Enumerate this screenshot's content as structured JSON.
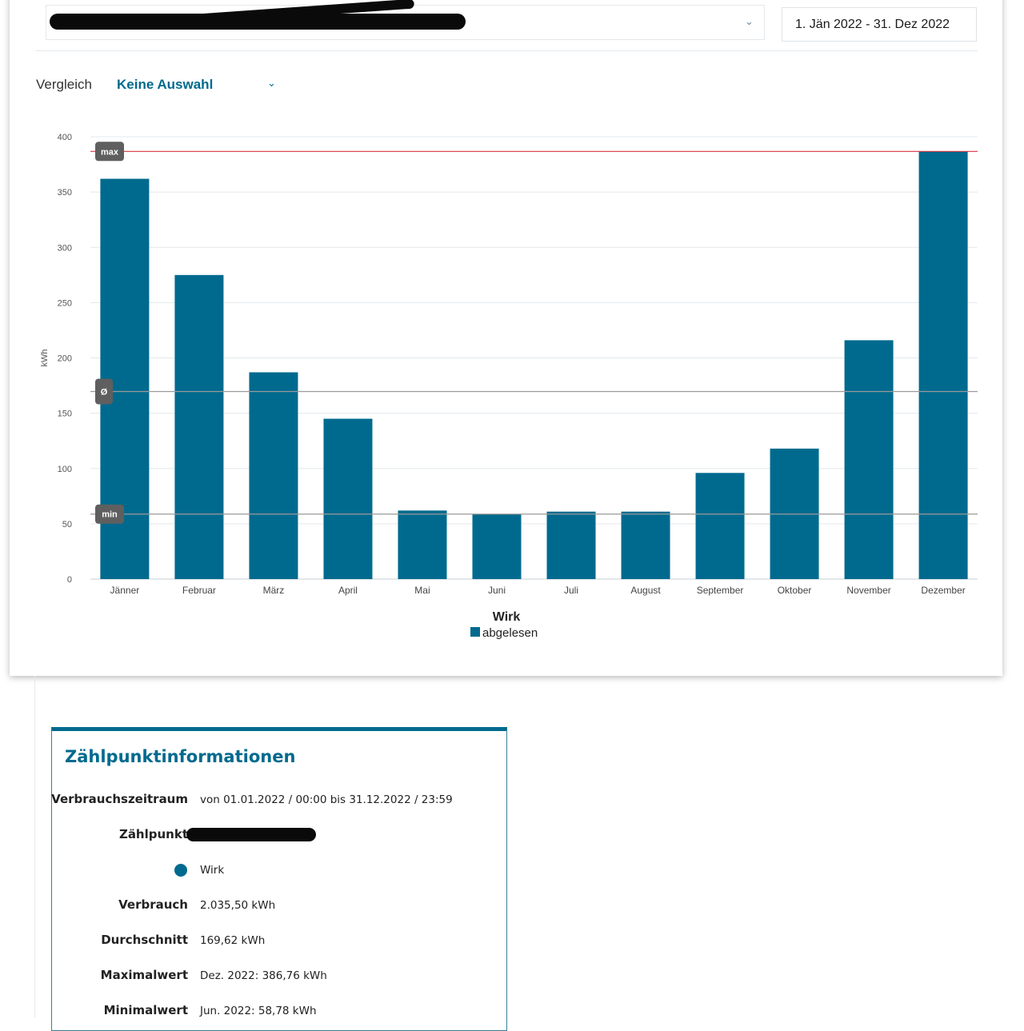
{
  "header": {
    "date_range": "1. Jän 2022 - 31. Dez 2022"
  },
  "comparison": {
    "label": "Vergleich",
    "selected": "Keine Auswahl"
  },
  "colors": {
    "accent": "#006a8e",
    "max_line": "#d9353f",
    "ref_line": "#9a9a9a",
    "badge": "#5f5f5f"
  },
  "chart_data": {
    "type": "bar",
    "title": "Wirk",
    "ylabel": "kWh",
    "ylim": [
      0,
      400
    ],
    "yticks": [
      0,
      50,
      100,
      150,
      200,
      250,
      300,
      350,
      400
    ],
    "categories": [
      "Jänner",
      "Februar",
      "März",
      "April",
      "Mai",
      "Juni",
      "Juli",
      "August",
      "September",
      "Oktober",
      "November",
      "Dezember"
    ],
    "series": [
      {
        "name": "abgelesen",
        "values": [
          362,
          275,
          187,
          145,
          62,
          58.78,
          61,
          61,
          96,
          118,
          216,
          386.76
        ]
      }
    ],
    "reference_lines": [
      {
        "label": "max",
        "value": 386.76
      },
      {
        "label": "Ø",
        "value": 169.62
      },
      {
        "label": "min",
        "value": 58.78
      }
    ],
    "legend": "bottom-center",
    "grid": true
  },
  "info": {
    "title": "Zählpunktinformationen",
    "rows": [
      {
        "label": "Verbrauchszeitraum",
        "value": "von 01.01.2022 / 00:00 bis 31.12.2022 / 23:59"
      },
      {
        "label": "Zählpunkt",
        "value": ""
      },
      {
        "label": "",
        "value": "Wirk"
      },
      {
        "label": "Verbrauch",
        "value": "2.035,50 kWh"
      },
      {
        "label": "Durchschnitt",
        "value": "169,62 kWh"
      },
      {
        "label": "Maximalwert",
        "value": "Dez. 2022: 386,76 kWh"
      },
      {
        "label": "Minimalwert",
        "value": "Jun. 2022: 58,78 kWh"
      }
    ]
  }
}
